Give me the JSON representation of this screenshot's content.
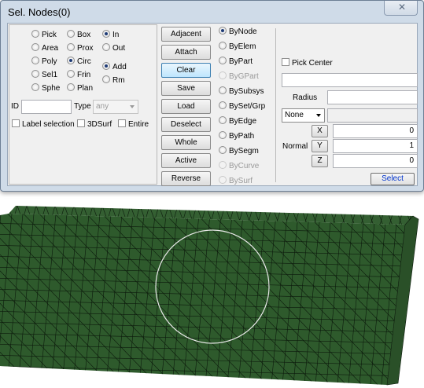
{
  "window": {
    "title": "Sel. Nodes(0)",
    "close_glyph": "✕"
  },
  "colors": {
    "mesh_fill": "#2e5a2c",
    "mesh_lines": "#0c1a0c",
    "selection_circle": "#e8e8e8",
    "dialog_bg": "#cfdbe8",
    "active_button": "#bee6fd"
  },
  "shape_radios": [
    {
      "label": "Pick",
      "selected": false
    },
    {
      "label": "Area",
      "selected": false
    },
    {
      "label": "Poly",
      "selected": false
    },
    {
      "label": "Sel1",
      "selected": false
    },
    {
      "label": "Sphe",
      "selected": false
    },
    {
      "label": "Box",
      "selected": false
    },
    {
      "label": "Prox",
      "selected": false
    },
    {
      "label": "Circ",
      "selected": true
    },
    {
      "label": "Frin",
      "selected": false
    },
    {
      "label": "Plan",
      "selected": false
    }
  ],
  "inout_radios": [
    {
      "label": "In",
      "selected": true
    },
    {
      "label": "Out",
      "selected": false
    }
  ],
  "addrm_radios": [
    {
      "label": "Add",
      "selected": true
    },
    {
      "label": "Rm",
      "selected": false
    }
  ],
  "id_label": "ID",
  "id_value": "",
  "type_label": "Type",
  "type_value": "any",
  "checkboxes": {
    "label_selection": "Label selection",
    "surf3d": "3DSurf",
    "entire": "Entire"
  },
  "buttons": [
    {
      "label": "Adjacent",
      "active": false
    },
    {
      "label": "Attach",
      "active": false
    },
    {
      "label": "Clear",
      "active": true
    },
    {
      "label": "Save",
      "active": false
    },
    {
      "label": "Load",
      "active": false
    },
    {
      "label": "Deselect",
      "active": false
    },
    {
      "label": "Whole",
      "active": false
    },
    {
      "label": "Active",
      "active": false
    },
    {
      "label": "Reverse",
      "active": false
    }
  ],
  "by_radios": [
    {
      "label": "ByNode",
      "selected": true,
      "enabled": true
    },
    {
      "label": "ByElem",
      "selected": false,
      "enabled": true
    },
    {
      "label": "ByPart",
      "selected": false,
      "enabled": true
    },
    {
      "label": "ByGPart",
      "selected": false,
      "enabled": false
    },
    {
      "label": "BySubsys",
      "selected": false,
      "enabled": true
    },
    {
      "label": "BySet/Grp",
      "selected": false,
      "enabled": true
    },
    {
      "label": "ByEdge",
      "selected": false,
      "enabled": true
    },
    {
      "label": "ByPath",
      "selected": false,
      "enabled": true
    },
    {
      "label": "BySegm",
      "selected": false,
      "enabled": true
    },
    {
      "label": "ByCurve",
      "selected": false,
      "enabled": false
    },
    {
      "label": "BySurf",
      "selected": false,
      "enabled": false
    }
  ],
  "pick_center": {
    "label": "Pick Center",
    "checked": false
  },
  "radius": {
    "label": "Radius",
    "value": ""
  },
  "none_select": {
    "value": "None"
  },
  "normal": {
    "label": "Normal",
    "x_label": "X",
    "y_label": "Y",
    "z_label": "Z",
    "x_value": "0",
    "y_value": "1",
    "z_value": "0"
  },
  "select_button": "Select"
}
